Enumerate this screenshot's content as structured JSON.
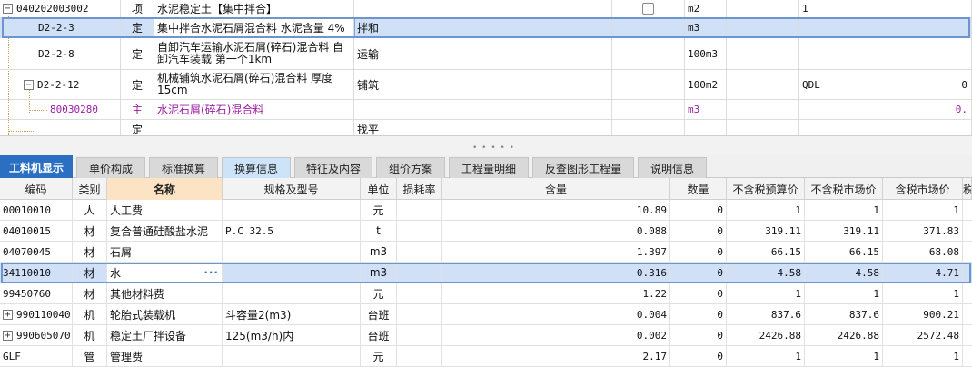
{
  "upper": {
    "rows": [
      {
        "code": "040202003002",
        "type": "项",
        "name": "水泥稳定土【集中拌合】",
        "desc": "",
        "unit": "m2",
        "qty_expr": "1",
        "amount": ""
      },
      {
        "code": "D2-2-3",
        "type": "定",
        "name": "集中拌合水泥石屑混合料 水泥含量 4%",
        "desc": "拌和",
        "unit": "m3",
        "qty_expr": "",
        "amount": ""
      },
      {
        "code": "D2-2-8",
        "type": "定",
        "name": "自卸汽车运输水泥石屑(碎石)混合料 自卸汽车装载 第一个1km",
        "desc": "运输",
        "unit": "100m3",
        "qty_expr": "",
        "amount": ""
      },
      {
        "code": "D2-2-12",
        "type": "定",
        "name": "机械铺筑水泥石屑(碎石)混合料 厚度15cm",
        "desc": "铺筑",
        "unit": "100m2",
        "qty_expr": "QDL",
        "amount": "0"
      },
      {
        "code": "80030280",
        "type": "主",
        "name": "水泥石屑(碎石)混合料",
        "desc": "",
        "unit": "m3",
        "qty_expr": "",
        "amount": "0."
      },
      {
        "code": "",
        "type": "定",
        "name": "",
        "desc": "找平",
        "unit": "",
        "qty_expr": "",
        "amount": ""
      }
    ]
  },
  "tabs": [
    {
      "label": "工料机显示"
    },
    {
      "label": "单价构成"
    },
    {
      "label": "标准换算"
    },
    {
      "label": "换算信息"
    },
    {
      "label": "特征及内容"
    },
    {
      "label": "组价方案"
    },
    {
      "label": "工程量明细"
    },
    {
      "label": "反查图形工程量"
    },
    {
      "label": "说明信息"
    }
  ],
  "lower": {
    "headers": [
      "编码",
      "类别",
      "名称",
      "规格及型号",
      "单位",
      "损耗率",
      "含量",
      "数量",
      "不含税预算价",
      "不含税市场价",
      "含税市场价",
      "税"
    ],
    "rows": [
      {
        "code": "00010010",
        "cat": "人",
        "name": "人工费",
        "spec": "",
        "unit": "元",
        "loss": "",
        "content": "10.89",
        "qty": "0",
        "budget": "1",
        "market": "1",
        "taxmarket": "1"
      },
      {
        "code": "04010015",
        "cat": "材",
        "name": "复合普通硅酸盐水泥",
        "spec": "P.C 32.5",
        "unit": "t",
        "loss": "",
        "content": "0.088",
        "qty": "0",
        "budget": "319.11",
        "market": "319.11",
        "taxmarket": "371.83"
      },
      {
        "code": "04070045",
        "cat": "材",
        "name": "石屑",
        "spec": "",
        "unit": "m3",
        "loss": "",
        "content": "1.397",
        "qty": "0",
        "budget": "66.15",
        "market": "66.15",
        "taxmarket": "68.08"
      },
      {
        "code": "34110010",
        "cat": "材",
        "name": "水",
        "spec": "",
        "unit": "m3",
        "loss": "",
        "content": "0.316",
        "qty": "0",
        "budget": "4.58",
        "market": "4.58",
        "taxmarket": "4.71"
      },
      {
        "code": "99450760",
        "cat": "材",
        "name": "其他材料费",
        "spec": "",
        "unit": "元",
        "loss": "",
        "content": "1.22",
        "qty": "0",
        "budget": "1",
        "market": "1",
        "taxmarket": "1"
      },
      {
        "code": "990110040",
        "cat": "机",
        "name": "轮胎式装载机",
        "spec": "斗容量2(m3)",
        "unit": "台班",
        "loss": "",
        "content": "0.004",
        "qty": "0",
        "budget": "837.6",
        "market": "837.6",
        "taxmarket": "900.21"
      },
      {
        "code": "990605070",
        "cat": "机",
        "name": "稳定土厂拌设备",
        "spec": "125(m3/h)内",
        "unit": "台班",
        "loss": "",
        "content": "0.002",
        "qty": "0",
        "budget": "2426.88",
        "market": "2426.88",
        "taxmarket": "2572.48"
      },
      {
        "code": "GLF",
        "cat": "管",
        "name": "管理费",
        "spec": "",
        "unit": "元",
        "loss": "",
        "content": "2.17",
        "qty": "0",
        "budget": "1",
        "market": "1",
        "taxmarket": "1"
      }
    ],
    "edit_button": "···",
    "expand_glyph": "+",
    "collapse_glyph": "−"
  },
  "colors": {
    "selection": "#cfe0f7",
    "active_tab": "#2a6fc2",
    "main_material": "#9b1fa3"
  }
}
